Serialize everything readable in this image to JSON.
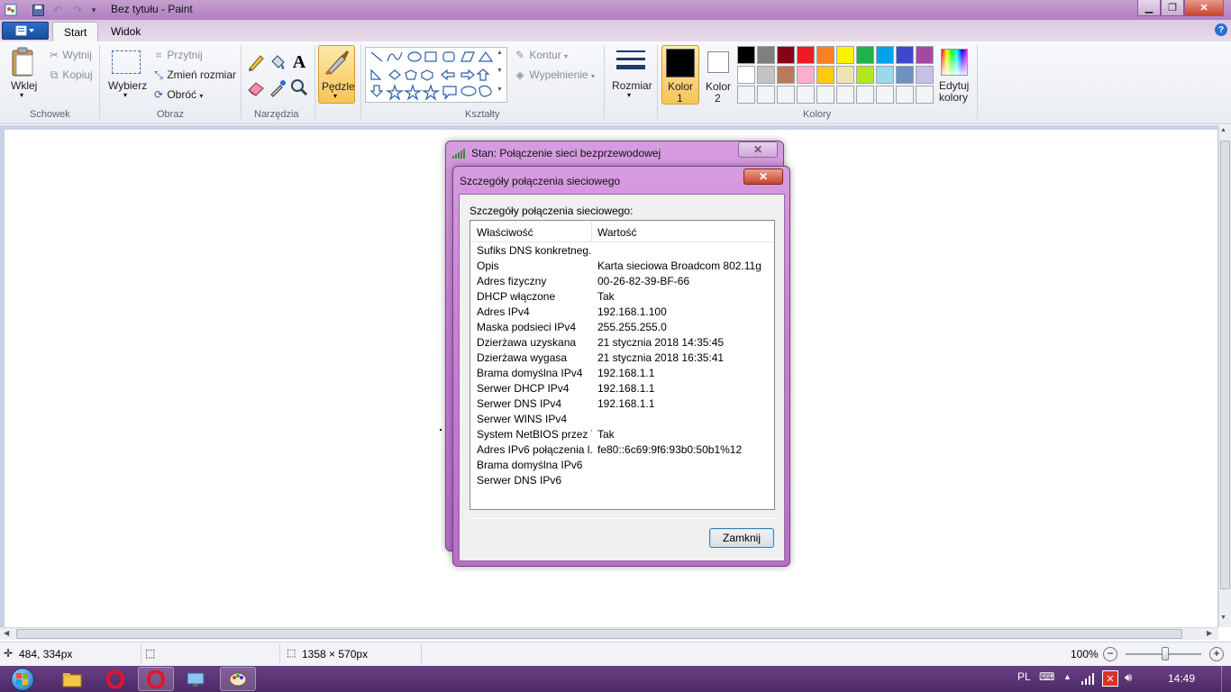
{
  "window": {
    "title": "Bez tytułu - Paint"
  },
  "tabs": [
    {
      "label": "Start"
    },
    {
      "label": "Widok"
    }
  ],
  "ribbon": {
    "clipboard": {
      "paste": "Wklej",
      "cut": "Wytnij",
      "copy": "Kopiuj",
      "group": "Schowek"
    },
    "image": {
      "select": "Wybierz",
      "crop": "Przytnij",
      "resize": "Zmień rozmiar",
      "rotate": "Obróć",
      "group": "Obraz"
    },
    "tools": {
      "group": "Narzędzia"
    },
    "brushes": {
      "label": "Pędzle"
    },
    "shapes": {
      "outline": "Kontur",
      "fill": "Wypełnienie",
      "group": "Kształty"
    },
    "size": {
      "label": "Rozmiar"
    },
    "color1": {
      "label": "Kolor",
      "num": "1"
    },
    "color2": {
      "label": "Kolor",
      "num": "2"
    },
    "edit_colors": {
      "line1": "Edytuj",
      "line2": "kolory"
    },
    "colors_group": "Kolory",
    "palette_row1": [
      "#000000",
      "#7f7f7f",
      "#880015",
      "#ed1c24",
      "#ff7f27",
      "#fff200",
      "#22b14c",
      "#00a2e8",
      "#3f48cc",
      "#a349a4"
    ],
    "palette_row2": [
      "#ffffff",
      "#c3c3c3",
      "#b97a57",
      "#ffaec9",
      "#ffc90e",
      "#efe4b0",
      "#b5e61d",
      "#99d9ea",
      "#7092be",
      "#c8bfe7"
    ]
  },
  "back_dialog": {
    "title": "Stan: Połączenie sieci bezprzewodowej"
  },
  "dialog": {
    "title": "Szczegóły połączenia sieciowego",
    "group_label": "Szczegóły połączenia sieciowego:",
    "col_property": "Właściwość",
    "col_value": "Wartość",
    "rows": [
      {
        "prop": "Sufiks DNS konkretneg...",
        "val": ""
      },
      {
        "prop": "Opis",
        "val": "Karta sieciowa Broadcom 802.11g"
      },
      {
        "prop": "Adres fizyczny",
        "val": "00-26-82-39-BF-66"
      },
      {
        "prop": "DHCP włączone",
        "val": "Tak"
      },
      {
        "prop": "Adres IPv4",
        "val": "192.168.1.100"
      },
      {
        "prop": "Maska podsieci IPv4",
        "val": "255.255.255.0"
      },
      {
        "prop": "Dzierżawa uzyskana",
        "val": "21 stycznia 2018 14:35:45"
      },
      {
        "prop": "Dzierżawa wygasa",
        "val": "21 stycznia 2018 16:35:41"
      },
      {
        "prop": "Brama domyślna IPv4",
        "val": "192.168.1.1"
      },
      {
        "prop": "Serwer DHCP IPv4",
        "val": "192.168.1.1"
      },
      {
        "prop": "Serwer DNS IPv4",
        "val": "192.168.1.1"
      },
      {
        "prop": "Serwer WINS IPv4",
        "val": ""
      },
      {
        "prop": "System NetBIOS przez T...",
        "val": "Tak"
      },
      {
        "prop": "Adres IPv6 połączenia l...",
        "val": "fe80::6c69:9f6:93b0:50b1%12"
      },
      {
        "prop": "Brama domyślna IPv6",
        "val": ""
      },
      {
        "prop": "Serwer DNS IPv6",
        "val": ""
      }
    ],
    "close_button": "Zamknij"
  },
  "statusbar": {
    "cursor": "484, 334px",
    "canvas_size": "1358 × 570px",
    "zoom": "100%",
    "zoom_level": 1.0
  },
  "taskbar": {
    "lang": "PL",
    "time": "14:49"
  }
}
